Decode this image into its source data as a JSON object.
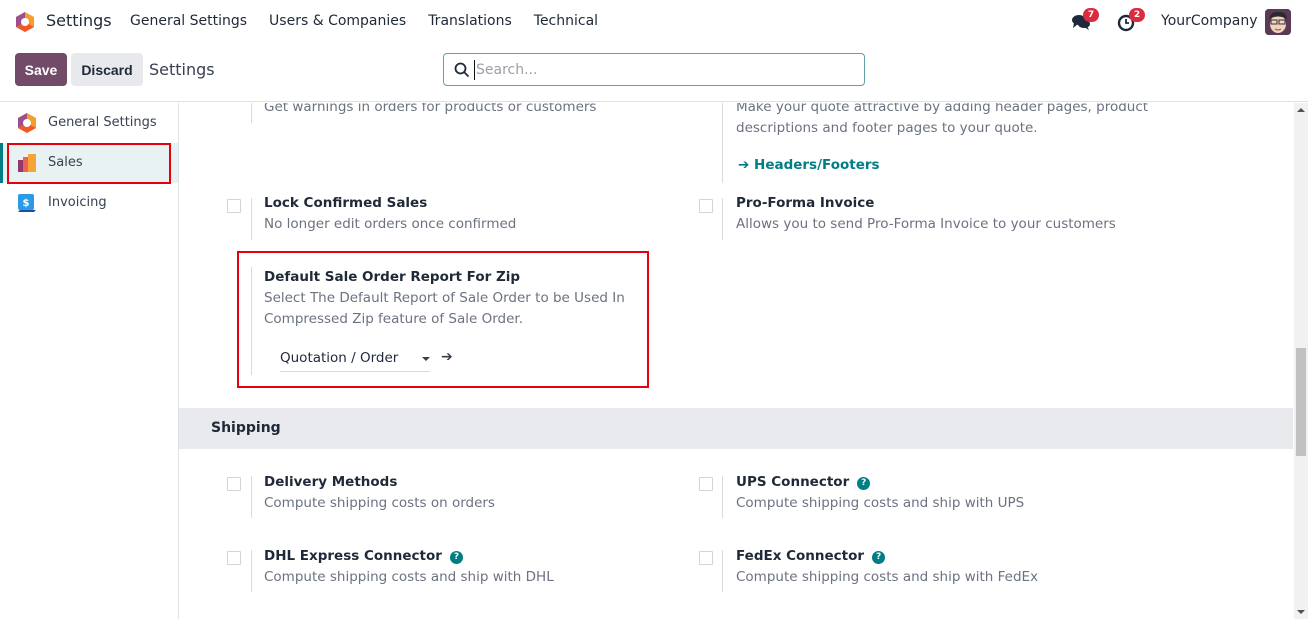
{
  "navbar": {
    "app_title": "Settings",
    "menu": [
      "General Settings",
      "Users & Companies",
      "Translations",
      "Technical"
    ],
    "messages_badge": "7",
    "activities_badge": "2",
    "company": "YourCompany"
  },
  "control_panel": {
    "save_label": "Save",
    "discard_label": "Discard",
    "breadcrumb": "Settings",
    "search_placeholder": "Search...",
    "search_value": ""
  },
  "sidebar": {
    "items": [
      {
        "label": "General Settings",
        "icon": "settings-app-icon",
        "active": false
      },
      {
        "label": "Sales",
        "icon": "sales-app-icon",
        "active": true
      },
      {
        "label": "Invoicing",
        "icon": "invoicing-app-icon",
        "active": false
      }
    ]
  },
  "content": {
    "partial_top_left_desc": "Get warnings in orders for products or customers",
    "partial_top_right_desc_1": "Make your quote attractive by adding header pages, product",
    "partial_top_right_desc_2": "descriptions and footer pages to your quote.",
    "headers_footers_link": "Headers/Footers",
    "lock_confirmed": {
      "title": "Lock Confirmed Sales",
      "desc": "No longer edit orders once confirmed",
      "checked": false
    },
    "pro_forma": {
      "title": "Pro-Forma Invoice",
      "desc": "Allows you to send Pro-Forma Invoice to your customers",
      "checked": false
    },
    "zip_report": {
      "title": "Default Sale Order Report For Zip",
      "desc_1": "Select The Default Report of Sale Order to be Used In",
      "desc_2": "Compressed Zip feature of Sale Order.",
      "selected": "Quotation / Order"
    },
    "shipping": {
      "section_title": "Shipping",
      "settings": [
        {
          "title": "Delivery Methods",
          "desc": "Compute shipping costs on orders",
          "help": false,
          "checked": false
        },
        {
          "title": "UPS Connector",
          "desc": "Compute shipping costs and ship with UPS",
          "help": true,
          "checked": false
        },
        {
          "title": "DHL Express Connector",
          "desc": "Compute shipping costs and ship with DHL",
          "help": true,
          "checked": false
        },
        {
          "title": "FedEx Connector",
          "desc": "Compute shipping costs and ship with FedEx",
          "help": true,
          "checked": false
        }
      ]
    },
    "help_glyph": "?",
    "arrow_glyph": "➔"
  },
  "colors": {
    "primary": "#714b67",
    "accent": "#017e84",
    "badge": "#dc2b3f",
    "highlight": "#e6000e"
  }
}
